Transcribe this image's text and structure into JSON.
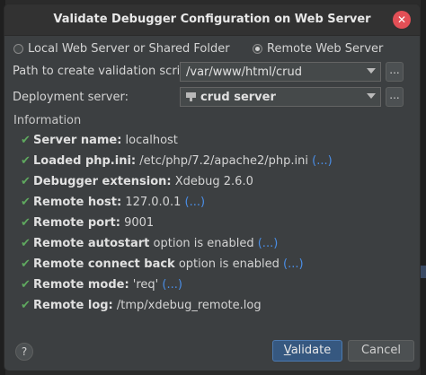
{
  "dialog": {
    "title": "Validate Debugger Configuration on Web Server"
  },
  "radios": [
    {
      "label": "Local Web Server or Shared Folder",
      "checked": false
    },
    {
      "label": "Remote Web Server",
      "checked": true
    }
  ],
  "path_field": {
    "label": "Path to create validation script:",
    "value": "/var/www/html/crud",
    "browse_label": "..."
  },
  "deployment_field": {
    "label": "Deployment server:",
    "value": "crud server",
    "browse_label": "..."
  },
  "information": {
    "header": "Information",
    "items": [
      {
        "bold": "Server name:",
        "text": " localhost",
        "link": ""
      },
      {
        "bold": "Loaded php.ini:",
        "text": " /etc/php/7.2/apache2/php.ini ",
        "link": "(...)"
      },
      {
        "bold": "Debugger extension:",
        "text": " Xdebug 2.6.0",
        "link": ""
      },
      {
        "bold": "Remote host:",
        "text": " 127.0.0.1 ",
        "link": "(...)"
      },
      {
        "bold": "Remote port:",
        "text": " 9001",
        "link": ""
      },
      {
        "bold": "Remote autostart",
        "text": " option is enabled ",
        "link": "(...)"
      },
      {
        "bold": "Remote connect back",
        "text": " option is enabled ",
        "link": "(...)"
      },
      {
        "bold": "Remote mode:",
        "text": " 'req' ",
        "link": "(...)"
      },
      {
        "bold": "Remote log:",
        "text": " /tmp/xdebug_remote.log",
        "link": ""
      }
    ]
  },
  "buttons": {
    "help": "?",
    "validate_mnemonic": "V",
    "validate_rest": "alidate",
    "cancel": "Cancel"
  },
  "icons": {
    "close": "close-icon",
    "check": "check-icon",
    "server": "server-icon",
    "dropdown": "chevron-down-icon"
  },
  "colors": {
    "check": "#5fa85f",
    "link": "#4a8ee6",
    "primary_button": "#365880",
    "close_button": "#e24f56"
  }
}
